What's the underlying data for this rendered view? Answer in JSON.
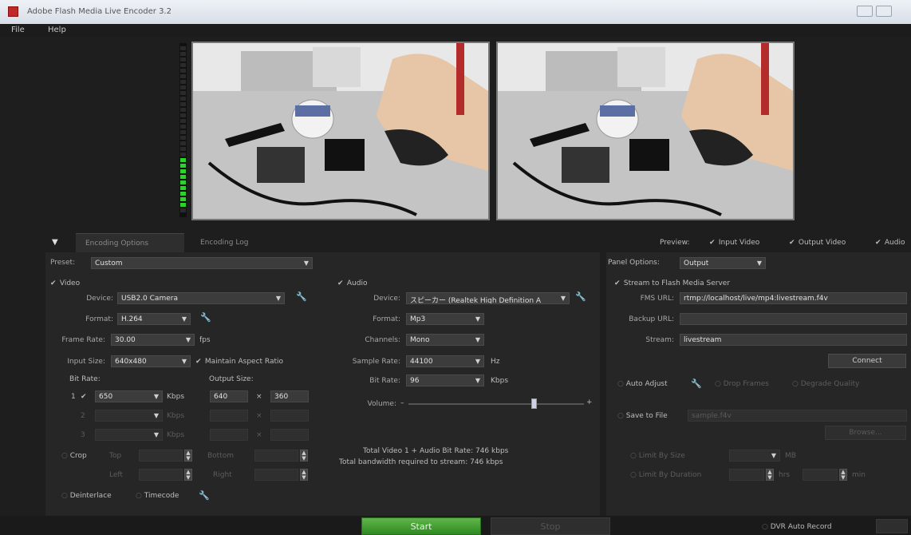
{
  "window": {
    "title": "Adobe Flash Media Live Encoder 3.2"
  },
  "menu": {
    "file": "File",
    "help": "Help"
  },
  "tabs": {
    "encoding_options": "Encoding Options",
    "encoding_log": "Encoding Log"
  },
  "preview": {
    "label": "Preview:",
    "input_video": "Input Video",
    "output_video": "Output Video",
    "audio": "Audio"
  },
  "preset": {
    "label": "Preset:",
    "value": "Custom"
  },
  "video": {
    "section": "Video",
    "device_label": "Device:",
    "device": "USB2.0 Camera",
    "format_label": "Format:",
    "format": "H.264",
    "frame_rate_label": "Frame Rate:",
    "frame_rate": "30.00",
    "fps": "fps",
    "input_size_label": "Input Size:",
    "input_size": "640x480",
    "maintain_aspect": "Maintain Aspect Ratio",
    "bit_rate_label": "Bit Rate:",
    "output_size_label": "Output Size:",
    "rows": [
      {
        "num": "1",
        "bitrate": "650",
        "unit": "Kbps",
        "w": "640",
        "h": "360"
      },
      {
        "num": "2",
        "bitrate": "",
        "unit": "Kbps",
        "w": "",
        "h": ""
      },
      {
        "num": "3",
        "bitrate": "",
        "unit": "Kbps",
        "w": "",
        "h": ""
      }
    ],
    "crop": "Crop",
    "top": "Top",
    "bottom": "Bottom",
    "left": "Left",
    "right": "Right",
    "deinterlace": "Deinterlace",
    "timecode": "Timecode"
  },
  "audio": {
    "section": "Audio",
    "device_label": "Device:",
    "device": "スピーカー (Realtek High Definition A",
    "format_label": "Format:",
    "format": "Mp3",
    "channels_label": "Channels:",
    "channels": "Mono",
    "sample_rate_label": "Sample Rate:",
    "sample_rate": "44100",
    "hz": "Hz",
    "bit_rate_label": "Bit Rate:",
    "bit_rate": "96",
    "kbps": "Kbps",
    "volume_label": "Volume:",
    "volume_level": 0.72,
    "minus": "–",
    "plus": "+",
    "total_line": "Total Video 1 + Audio Bit Rate: 746 kbps",
    "bandwidth_line": "Total bandwidth required to stream: 746 kbps"
  },
  "output": {
    "panel_options_label": "Panel Options:",
    "panel_options": "Output",
    "stream_to_fms": "Stream to Flash Media Server",
    "fms_url_label": "FMS URL:",
    "fms_url": "rtmp://localhost/live/mp4:livestream.f4v",
    "backup_url_label": "Backup URL:",
    "backup_url": "",
    "stream_label": "Stream:",
    "stream": "livestream",
    "connect": "Connect",
    "auto_adjust": "Auto Adjust",
    "drop_frames": "Drop Frames",
    "degrade_quality": "Degrade Quality",
    "save_to_file": "Save to File",
    "save_file": "sample.f4v",
    "browse": "Browse...",
    "limit_by_size": "Limit By Size",
    "size_unit": "MB",
    "limit_by_duration": "Limit By Duration",
    "hrs": "hrs",
    "min": "min"
  },
  "bottom": {
    "start": "Start",
    "stop": "Stop",
    "dvr": "DVR Auto Record"
  },
  "colors": {
    "start_green": "#3d9a2c",
    "vu_green": "#2ed12e",
    "background": "#1e1e1e"
  }
}
